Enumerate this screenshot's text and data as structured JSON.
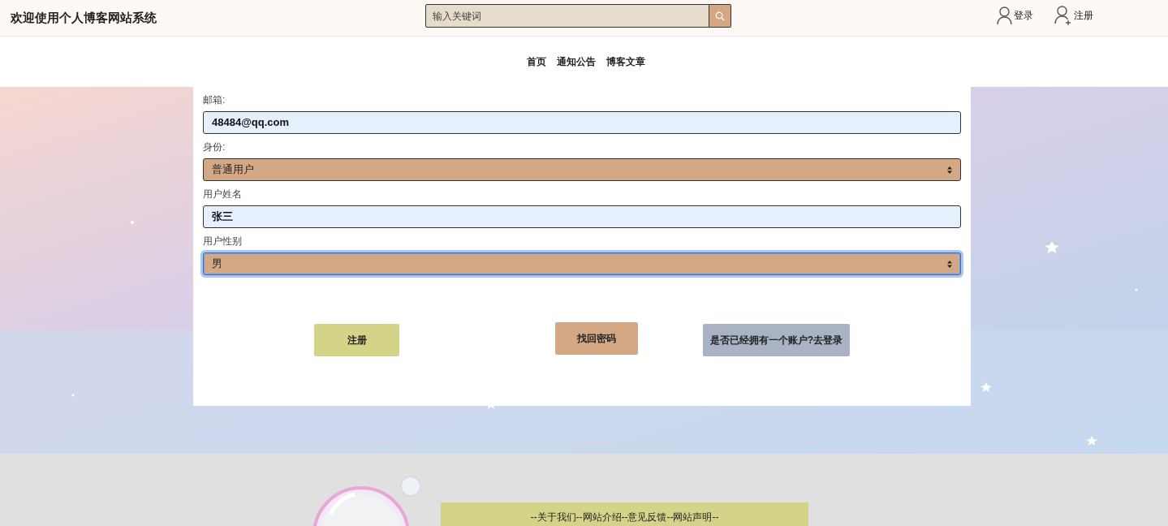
{
  "header": {
    "title": "欢迎使用个人博客网站系统",
    "search": {
      "placeholder": "输入关键词"
    },
    "links": [
      {
        "label": "登录",
        "kind": "user"
      },
      {
        "label": "注册",
        "kind": "add-user"
      }
    ]
  },
  "nav": [
    {
      "label": "首页"
    },
    {
      "label": "通知公告"
    },
    {
      "label": "博客文章"
    }
  ],
  "form": {
    "fields": [
      {
        "label": "邮箱:",
        "kind": "input",
        "value": "48484@qq.com",
        "focused": false
      },
      {
        "label": "身份:",
        "kind": "select",
        "value": "普通用户",
        "focused": false
      },
      {
        "label": "用户姓名",
        "kind": "input",
        "value": "张三",
        "focused": false
      },
      {
        "label": "用户性别",
        "kind": "select",
        "value": "男",
        "focused": true
      }
    ],
    "buttons": [
      {
        "label": "注册",
        "kind": "primary"
      },
      {
        "label": "找回密码",
        "kind": "secondary"
      },
      {
        "label": "是否已经拥有一个账户?去登录",
        "kind": "login"
      }
    ]
  },
  "footer": {
    "links": "--关于我们--网站介绍--意见反馈--网站声明--"
  }
}
